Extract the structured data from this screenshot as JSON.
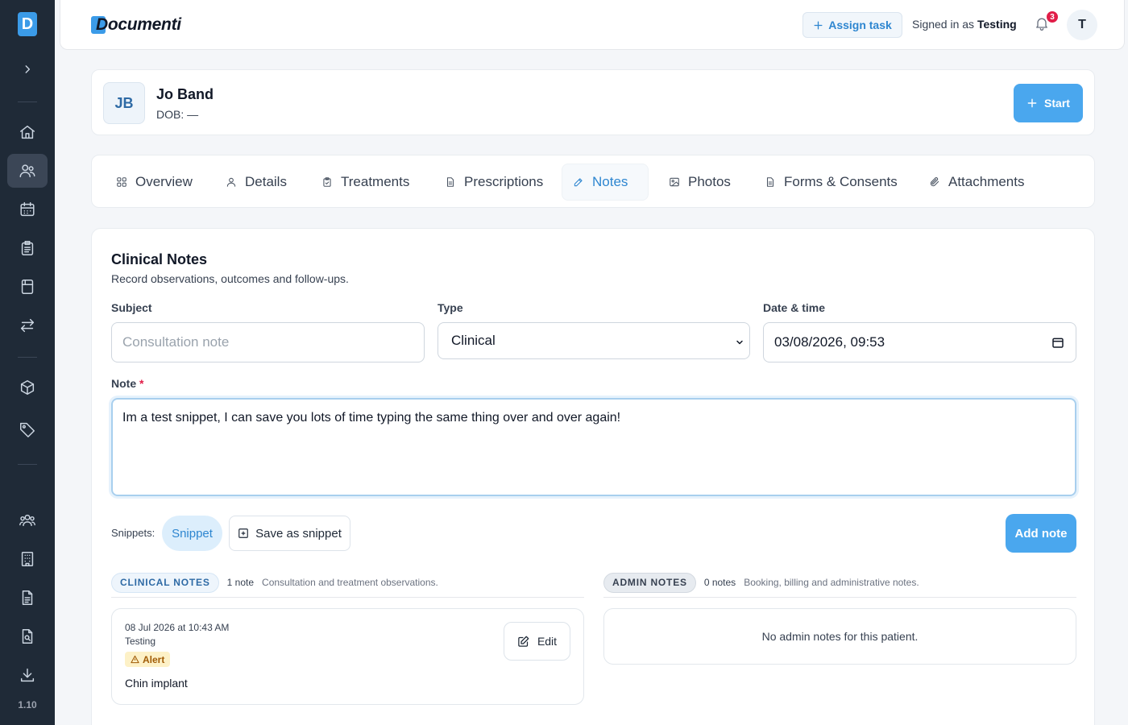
{
  "sidebar": {
    "logo_letter": "D",
    "version": "1.10",
    "icons": [
      "home-icon",
      "patients-icon",
      "calendar-icon",
      "clipboard-icon",
      "calculator-icon",
      "transfer-icon",
      "box-icon",
      "tag-icon",
      "team-icon",
      "building-icon",
      "document-icon",
      "search-doc-icon",
      "download-icon"
    ]
  },
  "header": {
    "brand": "Documenti",
    "assign_task": "Assign task",
    "signed_in_prefix": "Signed in as",
    "user_name": "Testing",
    "notification_count": "3",
    "avatar_initial": "T"
  },
  "patient": {
    "initials": "JB",
    "name": "Jo Band",
    "dob": "DOB: —",
    "start_label": "Start"
  },
  "tabs": [
    {
      "label": "Overview"
    },
    {
      "label": "Details"
    },
    {
      "label": "Treatments"
    },
    {
      "label": "Prescriptions"
    },
    {
      "label": "Notes"
    },
    {
      "label": "Photos"
    },
    {
      "label": "Forms & Consents"
    },
    {
      "label": "Attachments"
    }
  ],
  "active_tab": "Notes",
  "notes_form": {
    "title": "Clinical Notes",
    "subtitle": "Record observations, outcomes and follow-ups.",
    "subject_label": "Subject",
    "subject_placeholder": "Consultation note",
    "type_label": "Type",
    "type_value": "Clinical",
    "datetime_label": "Date & time",
    "datetime_value": "03/08/2026, 09:53",
    "note_label": "Note",
    "note_required": "*",
    "note_value": "Im a test snippet, I can save you lots of time typing the same thing over and over again!",
    "snippets_label": "Snippets:",
    "snippet_chip": "Snippet",
    "save_snippet": "Save as snippet",
    "add_note": "Add note"
  },
  "clinical_notes": {
    "badge": "CLINICAL NOTES",
    "count": "1 note",
    "description": "Consultation and treatment observations.",
    "items": [
      {
        "date": "08 Jul 2026 at 10:43 AM",
        "author": "Testing",
        "flag": "Alert",
        "text": "Chin implant",
        "edit": "Edit"
      }
    ]
  },
  "admin_notes": {
    "badge": "ADMIN NOTES",
    "count": "0 notes",
    "description": "Booking, billing and administrative notes.",
    "empty": "No admin notes for this patient."
  },
  "colors": {
    "accent": "#4aa7ee",
    "sidebar": "#1f2a37",
    "alert_bg": "#fdf1c7",
    "badge_red": "#e11d48"
  }
}
